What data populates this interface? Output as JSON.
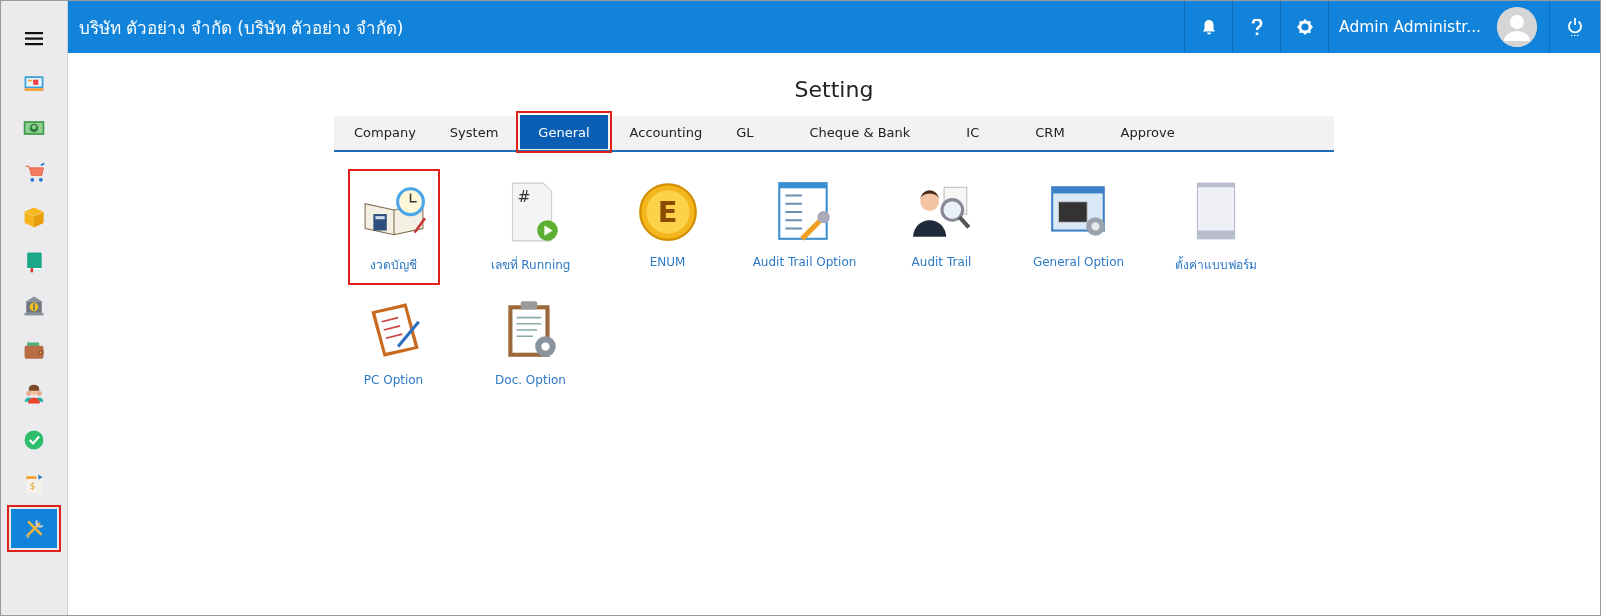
{
  "sidebar": {
    "items": [
      {
        "kind": "monitor",
        "selected": false,
        "highlighted": false
      },
      {
        "kind": "money",
        "selected": false,
        "highlighted": false
      },
      {
        "kind": "cart",
        "selected": false,
        "highlighted": false
      },
      {
        "kind": "box",
        "selected": false,
        "highlighted": false
      },
      {
        "kind": "book",
        "selected": false,
        "highlighted": false
      },
      {
        "kind": "bank",
        "selected": false,
        "highlighted": false
      },
      {
        "kind": "wallet",
        "selected": false,
        "highlighted": false
      },
      {
        "kind": "people",
        "selected": false,
        "highlighted": false
      },
      {
        "kind": "check",
        "selected": false,
        "highlighted": false
      },
      {
        "kind": "invoice",
        "selected": false,
        "highlighted": false,
        "icon_text": "$"
      },
      {
        "kind": "tools",
        "selected": true,
        "highlighted": true
      }
    ]
  },
  "header": {
    "title": "บริษัท ตัวอย่าง จำกัด (บริษัท ตัวอย่าง จำกัด)",
    "user_name": "Admin Administr..."
  },
  "page_title": "Setting",
  "tabs": [
    {
      "label": "Company",
      "selected": false,
      "highlighted": false
    },
    {
      "label": "System",
      "selected": false,
      "highlighted": false
    },
    {
      "label": "General",
      "selected": true,
      "highlighted": true
    },
    {
      "label": "Accounting",
      "selected": false,
      "highlighted": false
    },
    {
      "label": "GL",
      "selected": false,
      "highlighted": false
    },
    {
      "label": "Cheque & Bank",
      "selected": false,
      "highlighted": false
    },
    {
      "label": "IC",
      "selected": false,
      "highlighted": false
    },
    {
      "label": "CRM",
      "selected": false,
      "highlighted": false
    },
    {
      "label": "Approve",
      "selected": false,
      "highlighted": false
    }
  ],
  "tiles": [
    {
      "label": "งวดบัญชี",
      "kind": "period",
      "highlighted": true
    },
    {
      "label": "เลขที่ Running",
      "kind": "running",
      "highlighted": false,
      "icon_text": "#"
    },
    {
      "label": "ENUM",
      "kind": "enum",
      "highlighted": false,
      "icon_text": "E"
    },
    {
      "label": "Audit Trail Option",
      "kind": "audit-option",
      "highlighted": false
    },
    {
      "label": "Audit Trail",
      "kind": "audit",
      "highlighted": false
    },
    {
      "label": "General Option",
      "kind": "general",
      "highlighted": false
    },
    {
      "label": "ตั้งค่าแบบฟอร์ม",
      "kind": "form",
      "highlighted": false
    },
    {
      "label": "PC Option",
      "kind": "pc",
      "highlighted": false
    },
    {
      "label": "Doc. Option",
      "kind": "doc",
      "highlighted": false
    }
  ]
}
